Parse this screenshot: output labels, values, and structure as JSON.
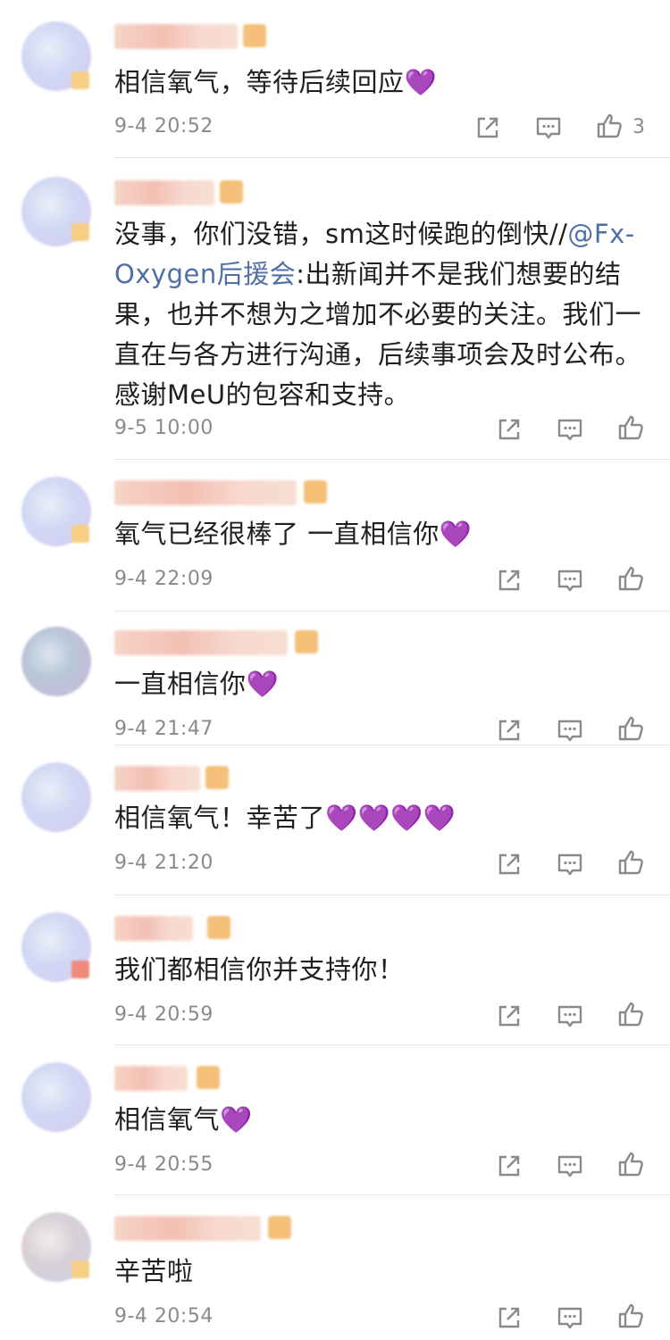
{
  "comments": [
    {
      "text": "相信氧气，等待后续回应💜",
      "time": "9-4 20:52",
      "likes": "3"
    },
    {
      "text_parts": [
        "没事，你们没错，sm这时候跑的倒快//",
        "@Fx-Oxygen后援会",
        ":出新闻并不是我们想要的结果，也并不想为之增加不必要的关注。我们一直在与各方进行沟通，后续事项会及时公布。感谢MeU的包容和支持。"
      ],
      "time": "9-5 10:00",
      "likes": ""
    },
    {
      "text": "氧气已经很棒了 一直相信你💜",
      "time": "9-4 22:09",
      "likes": ""
    },
    {
      "text": "一直相信你💜",
      "time": "9-4 21:47",
      "likes": ""
    },
    {
      "text": "相信氧气！幸苦了💜💜💜💜",
      "time": "9-4 21:20",
      "likes": ""
    },
    {
      "text": "我们都相信你并支持你！",
      "time": "9-4 20:59",
      "likes": ""
    },
    {
      "text": "相信氧气💜",
      "time": "9-4 20:55",
      "likes": ""
    },
    {
      "text": "辛苦啦",
      "time": "9-4 20:54",
      "likes": ""
    }
  ],
  "icons": {
    "share": "share-icon",
    "reply": "comment-icon",
    "like": "thumbs-up-icon"
  },
  "colors": {
    "mention": "#4f6fa6",
    "heart": "#9b3ddb",
    "meta": "#8a8a8a"
  }
}
